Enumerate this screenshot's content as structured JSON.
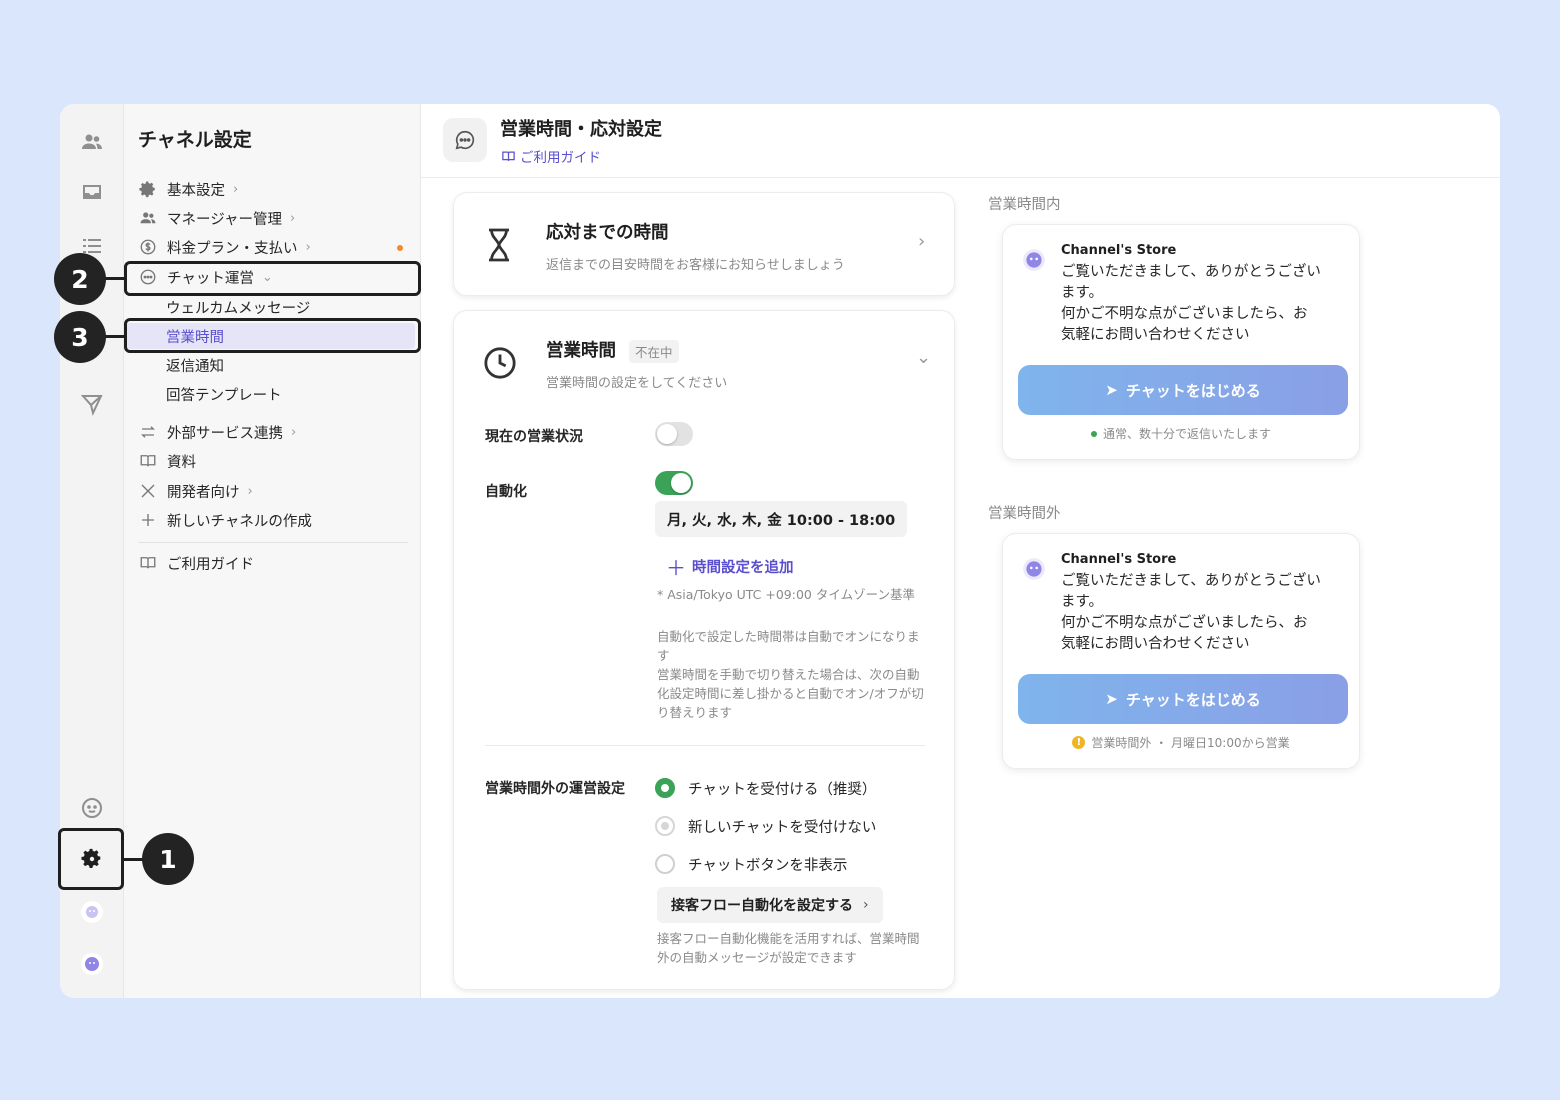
{
  "sidebar": {
    "title": "チャネル設定",
    "items": [
      {
        "label": "基本設定",
        "icon": "gear-icon"
      },
      {
        "label": "マネージャー管理",
        "icon": "users-icon"
      },
      {
        "label": "料金プラン・支払い",
        "icon": "dollar-icon"
      },
      {
        "label": "チャット運営",
        "icon": "chat-icon"
      }
    ],
    "sub_items": [
      "ウェルカムメッセージ",
      "営業時間",
      "返信通知",
      "回答テンプレート"
    ],
    "more_items": [
      {
        "label": "外部サービス連携",
        "icon": "swap-icon"
      },
      {
        "label": "資料",
        "icon": "book-icon"
      },
      {
        "label": "開発者向け",
        "icon": "tools-icon"
      },
      {
        "label": "新しいチャネルの作成",
        "icon": "plus-icon"
      }
    ],
    "guide": "ご利用ガイド"
  },
  "header": {
    "title": "営業時間・応対設定",
    "guide_link": "ご利用ガイド"
  },
  "response_card": {
    "title": "応対までの時間",
    "subtitle": "返信までの目安時間をお客様にお知らせしましょう"
  },
  "hours_card": {
    "title": "営業時間",
    "badge": "不在中",
    "subtitle": "営業時間の設定をしてください",
    "current_status_label": "現在の営業状況",
    "current_status_on": false,
    "automation_label": "自動化",
    "automation_on": true,
    "schedule": "月, 火, 水, 木, 金 10:00 - 18:00",
    "add_time": "時間設定を追加",
    "timezone_note": "* Asia/Tokyo UTC +09:00 タイムゾーン基準",
    "auto_note": "自動化で設定した時間帯は自動でオンになります\n営業時間を手動で切り替えた場合は、次の自動化設定時間に差し掛かると自動でオン/オフが切り替えります",
    "offhours_label": "営業時間外の運営設定",
    "options": [
      "チャットを受付ける（推奨）",
      "新しいチャットを受付けない",
      "チャットボタンを非表示"
    ],
    "selected_option": 0,
    "flow_button": "接客フロー自動化を設定する",
    "flow_note": "接客フロー自動化機能を活用すれば、営業時間外の自動メッセージが設定できます"
  },
  "preview": {
    "in_hours_label": "営業時間内",
    "out_hours_label": "営業時間外",
    "store_name": "Channel's Store",
    "message": "ご覧いただきまして、ありがとうございます。\n何かご不明な点がございましたら、お気軽にお問い合わせください",
    "cta": "チャットをはじめる",
    "in_status": "通常、数十分で返信いたします",
    "out_status": "営業時間外 ・ 月曜日10:00から営業"
  },
  "callouts": [
    "1",
    "2",
    "3"
  ],
  "colors": {
    "accent": "#5a4fcf",
    "toggle_on": "#3aa357",
    "background": "#d9e6fb",
    "notification_dot": "#f08a2a"
  }
}
